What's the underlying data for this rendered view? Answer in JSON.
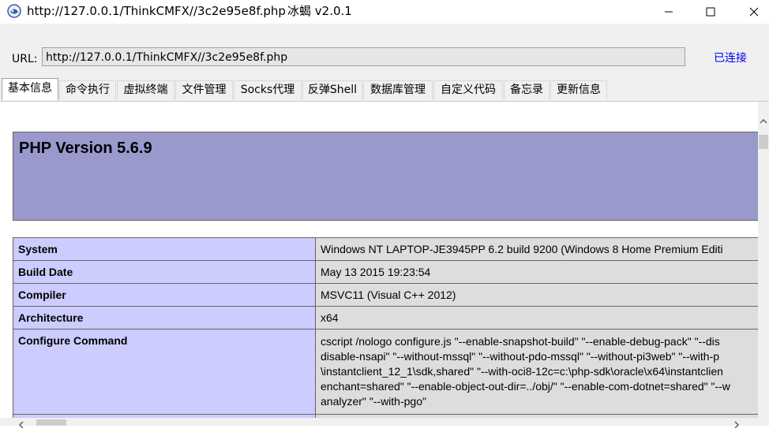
{
  "window": {
    "title": "http://127.0.0.1/ThinkCMFX//3c2e95e8f.php",
    "app_name": "冰蝎 v2.0.1"
  },
  "urlbar": {
    "label": "URL:",
    "value": "http://127.0.0.1/ThinkCMFX//3c2e95e8f.php",
    "status": "已连接"
  },
  "tabs": [
    {
      "label": "基本信息"
    },
    {
      "label": "命令执行"
    },
    {
      "label": "虚拟终端"
    },
    {
      "label": "文件管理"
    },
    {
      "label": "Socks代理"
    },
    {
      "label": "反弹Shell"
    },
    {
      "label": "数据库管理"
    },
    {
      "label": "自定义代码"
    },
    {
      "label": "备忘录"
    },
    {
      "label": "更新信息"
    }
  ],
  "active_tab": "基本信息",
  "phpinfo": {
    "version_title": "PHP Version 5.6.9",
    "rows": [
      {
        "key": "System",
        "value": "Windows NT LAPTOP-JE3945PP 6.2 build 9200 (Windows 8 Home Premium Editi"
      },
      {
        "key": "Build Date",
        "value": "May 13 2015 19:23:54"
      },
      {
        "key": "Compiler",
        "value": "MSVC11 (Visual C++ 2012)"
      },
      {
        "key": "Architecture",
        "value": "x64"
      },
      {
        "key": "Configure Command",
        "lines": [
          "cscript /nologo configure.js \"--enable-snapshot-build\" \"--enable-debug-pack\" \"--dis",
          "disable-nsapi\" \"--without-mssql\" \"--without-pdo-mssql\" \"--without-pi3web\" \"--with-p",
          "\\instantclient_12_1\\sdk,shared\" \"--with-oci8-12c=c:\\php-sdk\\oracle\\x64\\instantclien",
          "enchant=shared\" \"--enable-object-out-dir=../obj/\" \"--enable-com-dotnet=shared\" \"--w",
          "analyzer\" \"--with-pgo\""
        ]
      }
    ]
  },
  "colors": {
    "header_bg": "#9999cc",
    "key_bg": "#ccccff",
    "value_bg": "#dddddd",
    "link": "#0000ee"
  }
}
